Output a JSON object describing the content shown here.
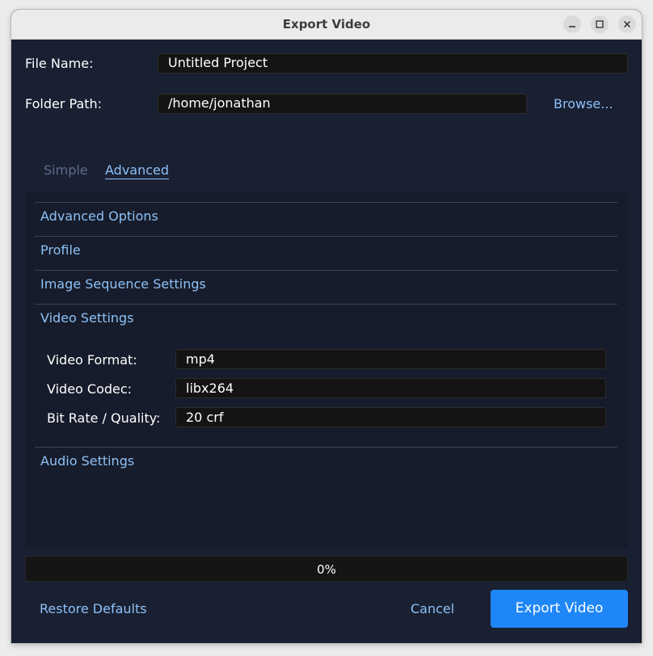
{
  "window": {
    "title": "Export Video",
    "controls": {
      "minimize": "minimize-icon",
      "maximize": "maximize-icon",
      "close": "close-icon"
    }
  },
  "form": {
    "file_name_label": "File Name:",
    "file_name_value": "Untitled Project",
    "folder_path_label": "Folder Path:",
    "folder_path_value": "/home/jonathan",
    "browse_label": "Browse..."
  },
  "tabs": [
    {
      "label": "Simple",
      "active": false
    },
    {
      "label": "Advanced",
      "active": true
    }
  ],
  "sections": {
    "advanced_options": "Advanced Options",
    "profile": "Profile",
    "image_sequence": "Image Sequence Settings",
    "video_settings": "Video Settings",
    "audio_settings": "Audio Settings"
  },
  "video_settings": {
    "format_label": "Video Format:",
    "format_value": "mp4",
    "codec_label": "Video Codec:",
    "codec_value": "libx264",
    "bitrate_label": "Bit Rate / Quality:",
    "bitrate_value": "20 crf"
  },
  "progress": {
    "value": 0,
    "text": "0%"
  },
  "footer": {
    "restore_label": "Restore Defaults",
    "cancel_label": "Cancel",
    "export_label": "Export Video"
  },
  "colors": {
    "background": "#192032",
    "panel": "#161c2b",
    "accent": "#1e86f7",
    "link": "#8ec0f5"
  }
}
